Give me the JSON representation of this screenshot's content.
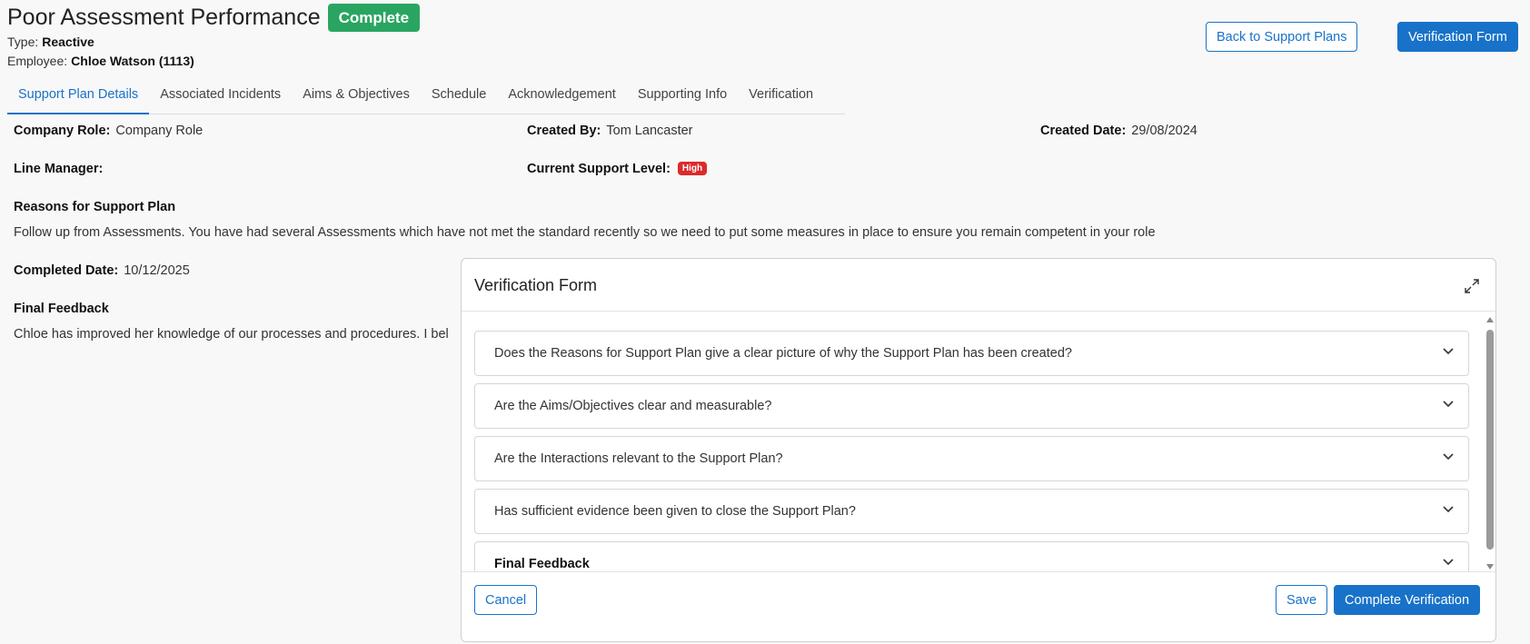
{
  "header": {
    "title": "Poor Assessment Performance",
    "status": "Complete",
    "type_label": "Type:",
    "type_value": "Reactive",
    "employee_label": "Employee:",
    "employee_value": "Chloe Watson (1113)",
    "back_button": "Back to Support Plans",
    "verification_button": "Verification Form"
  },
  "tabs": [
    {
      "label": "Support Plan Details",
      "active": true
    },
    {
      "label": "Associated Incidents",
      "active": false
    },
    {
      "label": "Aims & Objectives",
      "active": false
    },
    {
      "label": "Schedule",
      "active": false
    },
    {
      "label": "Acknowledgement",
      "active": false
    },
    {
      "label": "Supporting Info",
      "active": false
    },
    {
      "label": "Verification",
      "active": false
    }
  ],
  "details": {
    "company_role_label": "Company Role:",
    "company_role_value": "Company Role",
    "created_by_label": "Created By:",
    "created_by_value": "Tom Lancaster",
    "created_date_label": "Created Date:",
    "created_date_value": "29/08/2024",
    "line_manager_label": "Line Manager:",
    "line_manager_value": "",
    "support_level_label": "Current Support Level:",
    "support_level_value": "High",
    "support_level_color": "#dc2a2a",
    "reasons_heading": "Reasons for Support Plan",
    "reasons_text": "Follow up from Assessments. You have had several Assessments which have not met the standard recently so we need to put some measures in place to ensure you remain competent in your role",
    "completed_date_label": "Completed Date:",
    "completed_date_value": "10/12/2025",
    "final_feedback_heading": "Final Feedback",
    "final_feedback_text": "Chloe has improved her knowledge of our processes and procedures. I bel"
  },
  "modal": {
    "title": "Verification Form",
    "questions": [
      {
        "label": "Does the Reasons for Support Plan give a clear picture of why the Support Plan has been created?",
        "bold": false
      },
      {
        "label": "Are the Aims/Objectives clear and measurable?",
        "bold": false
      },
      {
        "label": "Are the Interactions relevant to the Support Plan?",
        "bold": false
      },
      {
        "label": "Has sufficient evidence been given to close the Support Plan?",
        "bold": false
      },
      {
        "label": "Final Feedback",
        "bold": true
      }
    ],
    "cancel_button": "Cancel",
    "save_button": "Save",
    "complete_button": "Complete Verification"
  },
  "colors": {
    "primary": "#1872c9",
    "complete_badge": "#2aa561"
  }
}
